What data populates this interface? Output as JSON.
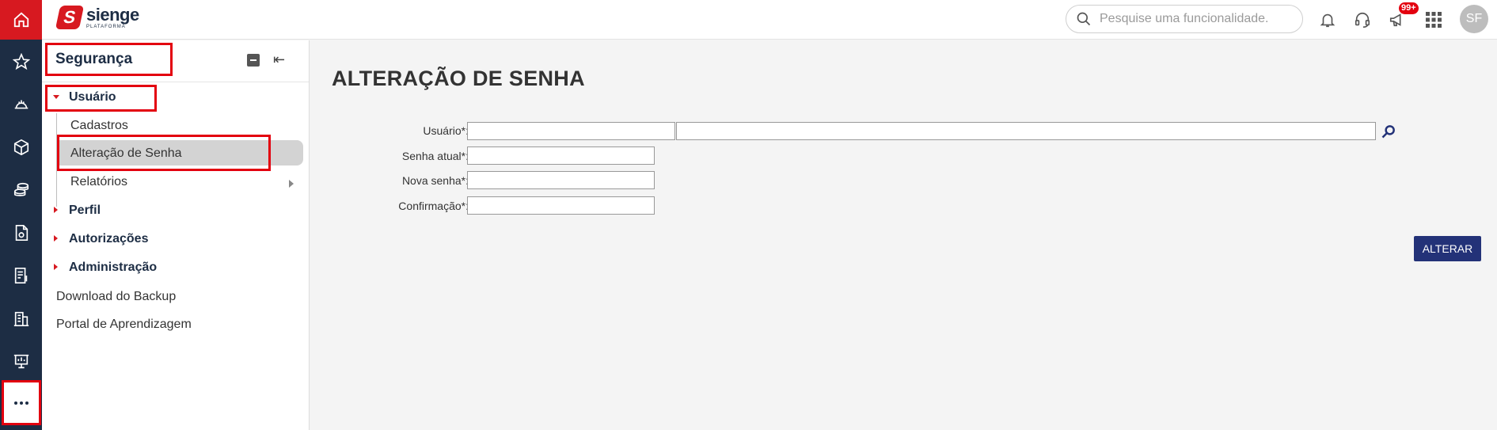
{
  "topbar": {
    "logo_name": "sienge",
    "logo_sub": "PLATAFORMA",
    "search_placeholder": "Pesquise uma funcionalidade.",
    "notifications_badge": "99+",
    "avatar_initials": "SF"
  },
  "rail": {
    "icons": [
      "home-icon",
      "star-icon",
      "helmet-icon",
      "box-icon",
      "coins-icon",
      "document-icon",
      "invoice-icon",
      "building-icon",
      "presentation-icon",
      "more-icon"
    ],
    "more_label": "···"
  },
  "sidemenu": {
    "title": "Segurança",
    "items": [
      {
        "label": "Usuário",
        "type": "group",
        "expanded": true
      },
      {
        "label": "Cadastros",
        "type": "sub"
      },
      {
        "label": "Alteração de Senha",
        "type": "sub",
        "active": true
      },
      {
        "label": "Relatórios",
        "type": "sub",
        "has_children": true
      },
      {
        "label": "Perfil",
        "type": "group",
        "expanded": false
      },
      {
        "label": "Autorizações",
        "type": "group",
        "expanded": false
      },
      {
        "label": "Administração",
        "type": "group",
        "expanded": false
      },
      {
        "label": "Download do Backup",
        "type": "link"
      },
      {
        "label": "Portal de Aprendizagem",
        "type": "link"
      }
    ]
  },
  "main": {
    "title": "ALTERAÇÃO DE SENHA",
    "form": {
      "usuario_label": "Usuário*:",
      "usuario_code": "",
      "usuario_name": "",
      "senha_atual_label": "Senha atual*:",
      "senha_atual": "",
      "nova_senha_label": "Nova senha*:",
      "nova_senha": "",
      "confirmacao_label": "Confirmação*:",
      "confirmacao": ""
    },
    "submit_label": "ALTERAR"
  },
  "colors": {
    "brand_red": "#d71920",
    "rail_bg": "#1d2d44",
    "button_bg": "#233278",
    "highlight_border": "#e3000f"
  }
}
